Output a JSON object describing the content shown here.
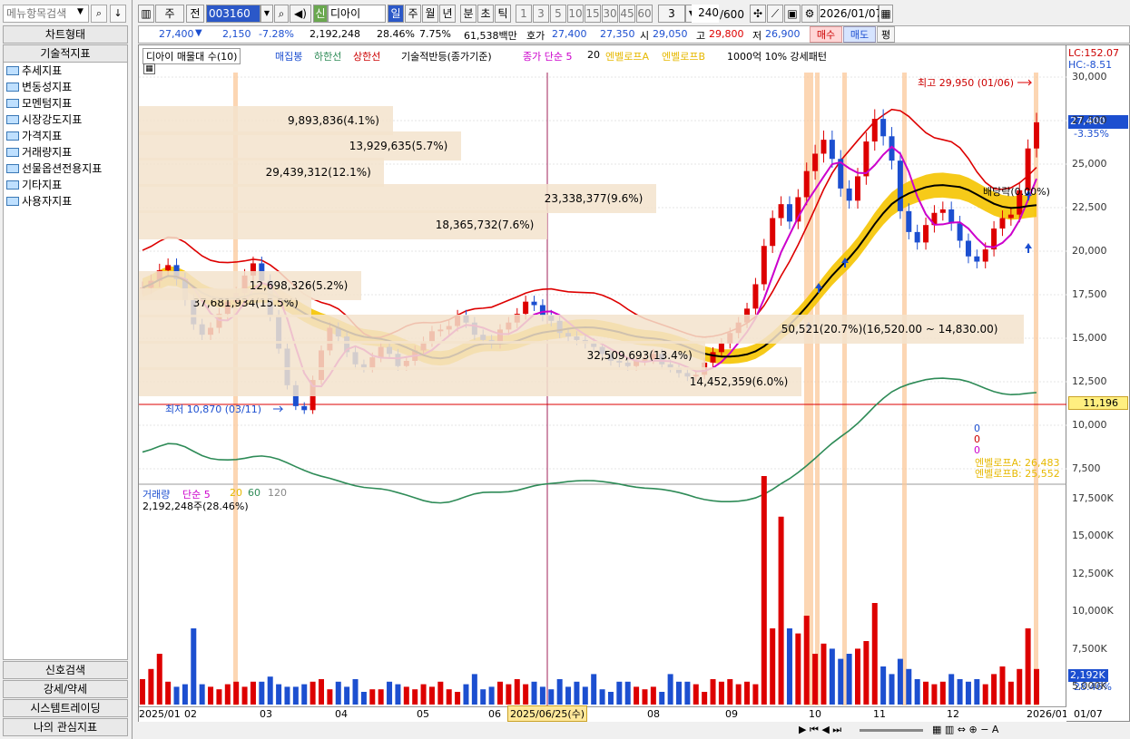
{
  "sidebar": {
    "search_placeholder": "메뉴항목검색",
    "chart_type": "차트형태",
    "tech_header": "기술적지표",
    "items": [
      "추세지표",
      "변동성지표",
      "모멘텀지표",
      "시장강도지표",
      "가격지표",
      "거래량지표",
      "선물옵션전용지표",
      "기타지표",
      "사용자지표"
    ],
    "bottom": [
      "신호검색",
      "강세/약세",
      "시스템트레이딩",
      "나의 관심지표"
    ]
  },
  "toolbar": {
    "ju": "주",
    "jeon": "전",
    "code": "003160",
    "sin": "신",
    "name": "디아이",
    "periods": [
      "일",
      "주",
      "월",
      "년",
      "분",
      "초",
      "틱"
    ],
    "nums": [
      "1",
      "3",
      "5",
      "10",
      "15",
      "30",
      "45",
      "60"
    ],
    "sel": "3",
    "count": "240",
    "max": "/600",
    "date": "2026/01/07"
  },
  "quote": {
    "price": "27,400",
    "arrow": "▼",
    "change": "2,150",
    "pct": "-7.28%",
    "volume": "2,192,248",
    "vol_pct": "28.46%",
    "turnover": "7.75%",
    "amount": "61,538백만",
    "hoga_lbl": "호가",
    "ask": "27,400",
    "bid": "27,350",
    "open_lbl": "시",
    "open": "29,050",
    "high_lbl": "고",
    "high": "29,800",
    "low_lbl": "저",
    "low": "26,900",
    "buy": "매수",
    "sell": "매도",
    "avg": "평"
  },
  "legend": {
    "title": "디아이 매물대 수(10)",
    "candle": "매집봉",
    "lower": "하한선",
    "upper": "상한선",
    "rebound": "기술적반등(종가기준)",
    "ma": "종가 단순 5",
    "ma20": "20",
    "envA": "엔벨로프A",
    "envB": "엔벨로프B",
    "pattern": "1000억 10% 강세패턴"
  },
  "volume_legend": {
    "title": "거래량",
    "ma": "단순 5",
    "p20": "20",
    "p60": "60",
    "p120": "120",
    "value": "2,192,248주(28.46%)"
  },
  "side_labels": {
    "lc": "LC:152.07",
    "hc": "HC:-8.51",
    "cur": "27,400",
    "cur_pct": "-3.35%",
    "line": "11,196",
    "vol_cur": "2,192K",
    "vol_pct": "28.46%",
    "zeros": [
      "0",
      "0",
      "0"
    ],
    "envA": "엔벨로프A: 26,483",
    "envB": "엔벨로프B: 25,552"
  },
  "annotations": {
    "high": "최고 29,950 (01/06)",
    "low": "최저 10,870 (03/11)",
    "dividend": "배당락(0.00%)",
    "cursor_date": "2025/06/25(수)"
  },
  "chart_data": {
    "type": "candlestick",
    "price_ticks": [
      "30,000",
      "27,500",
      "25,000",
      "22,500",
      "20,000",
      "17,500",
      "15,000",
      "12,500",
      "10,000",
      "7,500"
    ],
    "volume_ticks": [
      "17,500K",
      "15,000K",
      "12,500K",
      "10,000K",
      "7,500K",
      "5,000K"
    ],
    "x_labels": [
      "2025/01",
      "02",
      "03",
      "04",
      "05",
      "06",
      "08",
      "09",
      "10",
      "11",
      "12",
      "2026/01"
    ],
    "x_right": "01/07",
    "volume_profile": [
      {
        "label": "37,681,934(15.5%)",
        "level": 16500
      },
      {
        "label": "29,439,312(12.1%)",
        "level": 24000
      },
      {
        "label": "23,338,377(9.6%)",
        "level": 22500
      },
      {
        "label": "18,365,732(7.6%)",
        "level": 21000
      },
      {
        "label": "13,929,635(5.7%)",
        "level": 25500
      },
      {
        "label": "12,698,326(5.2%)",
        "level": 17500
      },
      {
        "label": "9,893,836(4.1%)",
        "level": 27000
      },
      {
        "label": "14,452,359(6.0%)",
        "level": 12000
      },
      {
        "label": "32,509,693(13.4%)",
        "level": 13500
      },
      {
        "label": "50,521(20.7%)(16,520.00 ~ 14,830.00)",
        "level": 15000
      }
    ],
    "close": [
      17900,
      18300,
      18900,
      19200,
      18400,
      17200,
      15800,
      15200,
      15600,
      16400,
      17100,
      17600,
      18600,
      19300,
      18300,
      16300,
      14400,
      12300,
      11100,
      10870,
      12600,
      14300,
      15600,
      15100,
      14200,
      13500,
      13300,
      13900,
      14500,
      14100,
      13400,
      13700,
      14300,
      14800,
      15400,
      15500,
      15700,
      16300,
      15900,
      15200,
      14900,
      14700,
      15500,
      15900,
      16400,
      17100,
      16900,
      16300,
      16000,
      15300,
      15100,
      14900,
      14700,
      14500,
      14100,
      13700,
      13600,
      13400,
      13700,
      13800,
      14100,
      13500,
      13300,
      13000,
      12800,
      12900,
      13600,
      14200,
      14700,
      15300,
      15900,
      16700,
      18100,
      20300,
      21900,
      22700,
      21700,
      23100,
      24600,
      25600,
      26400,
      25300,
      23600,
      22900,
      24300,
      26300,
      27600,
      26600,
      25200,
      22300,
      21100,
      20500,
      21500,
      22200,
      22400,
      21600,
      20600,
      19700,
      19400,
      20100,
      21300,
      21900,
      22100,
      23500,
      25900,
      27400
    ],
    "high": "29,950",
    "low": "10,870"
  }
}
